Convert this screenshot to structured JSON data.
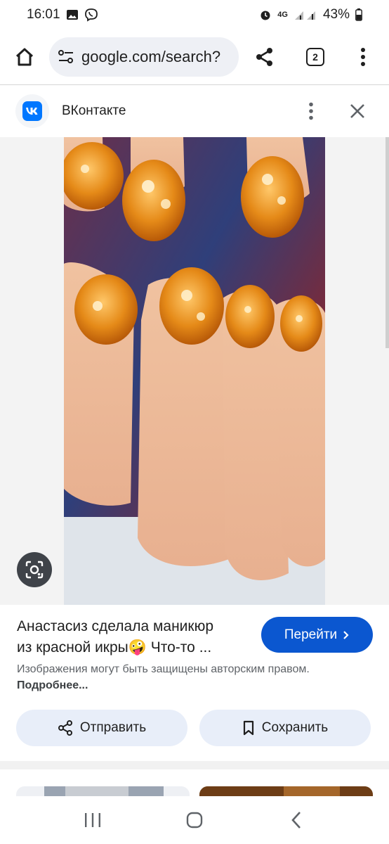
{
  "status_bar": {
    "time": "16:01",
    "battery": "43%",
    "network": "4G",
    "icons": [
      "gallery-icon",
      "viber-icon",
      "alarm-icon",
      "signal-icon",
      "battery-icon"
    ]
  },
  "browser": {
    "url": "google.com/search?",
    "tab_count": "2",
    "icons": [
      "home-icon",
      "site-settings-icon",
      "share-icon",
      "menu-icon"
    ]
  },
  "source": {
    "name": "ВКонтакте",
    "logo_color": "#0077ff"
  },
  "result": {
    "title_line1": "Анастасиз сделала маникюр",
    "title_line2": "из красной икры🤪 Что-то ...",
    "go_label": "Перейти",
    "copyright_text": "Изображения могут быть защищены авторским правом. ",
    "copyright_link": "Подробнее...",
    "share_label": "Отправить",
    "save_label": "Сохранить"
  },
  "colors": {
    "accent": "#0b57d0",
    "pill_bg": "#e8eef9",
    "omnibox_bg": "#eef0f5"
  }
}
